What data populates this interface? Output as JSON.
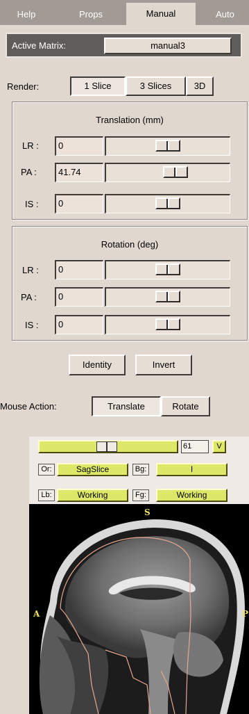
{
  "tabs": [
    {
      "label": "Help",
      "active": false
    },
    {
      "label": "Props",
      "active": false
    },
    {
      "label": "Manual",
      "active": true
    },
    {
      "label": "Auto",
      "active": false
    }
  ],
  "matrix": {
    "label": "Active Matrix:",
    "value": "manual3"
  },
  "render": {
    "label": "Render:",
    "options": [
      "1 Slice",
      "3 Slices",
      "3D"
    ],
    "selected": "1 Slice"
  },
  "translation": {
    "title": "Translation (mm)",
    "rows": [
      {
        "label": "LR :",
        "value": "0",
        "level": 0.5
      },
      {
        "label": "PA :",
        "value": "41.74",
        "level": 0.58
      },
      {
        "label": "IS :",
        "value": "0",
        "level": 0.5
      }
    ]
  },
  "rotation": {
    "title": "Rotation (deg)",
    "rows": [
      {
        "label": "LR :",
        "value": "0",
        "level": 0.5
      },
      {
        "label": "PA :",
        "value": "0",
        "level": 0.5
      },
      {
        "label": "IS :",
        "value": "0",
        "level": 0.5
      }
    ]
  },
  "actions": {
    "identity": "Identity",
    "invert": "Invert"
  },
  "mouse": {
    "label": "Mouse Action:",
    "options": [
      "Translate",
      "Rotate"
    ],
    "selected": "Translate"
  },
  "viewer": {
    "slice_value": "61",
    "v_button": "V",
    "or_label": "Or:",
    "or_value": "SagSlice",
    "bg_label": "Bg:",
    "bg_value": "I",
    "lb_label": "Lb:",
    "lb_value": "Working",
    "fg_label": "Fg:",
    "fg_value": "Working",
    "orient_top": "S",
    "orient_left": "A",
    "orient_right": "P"
  },
  "colors": {
    "accent_yellow": "#dde868",
    "outline": "#e8a890",
    "orient_text": "#f0e060"
  }
}
